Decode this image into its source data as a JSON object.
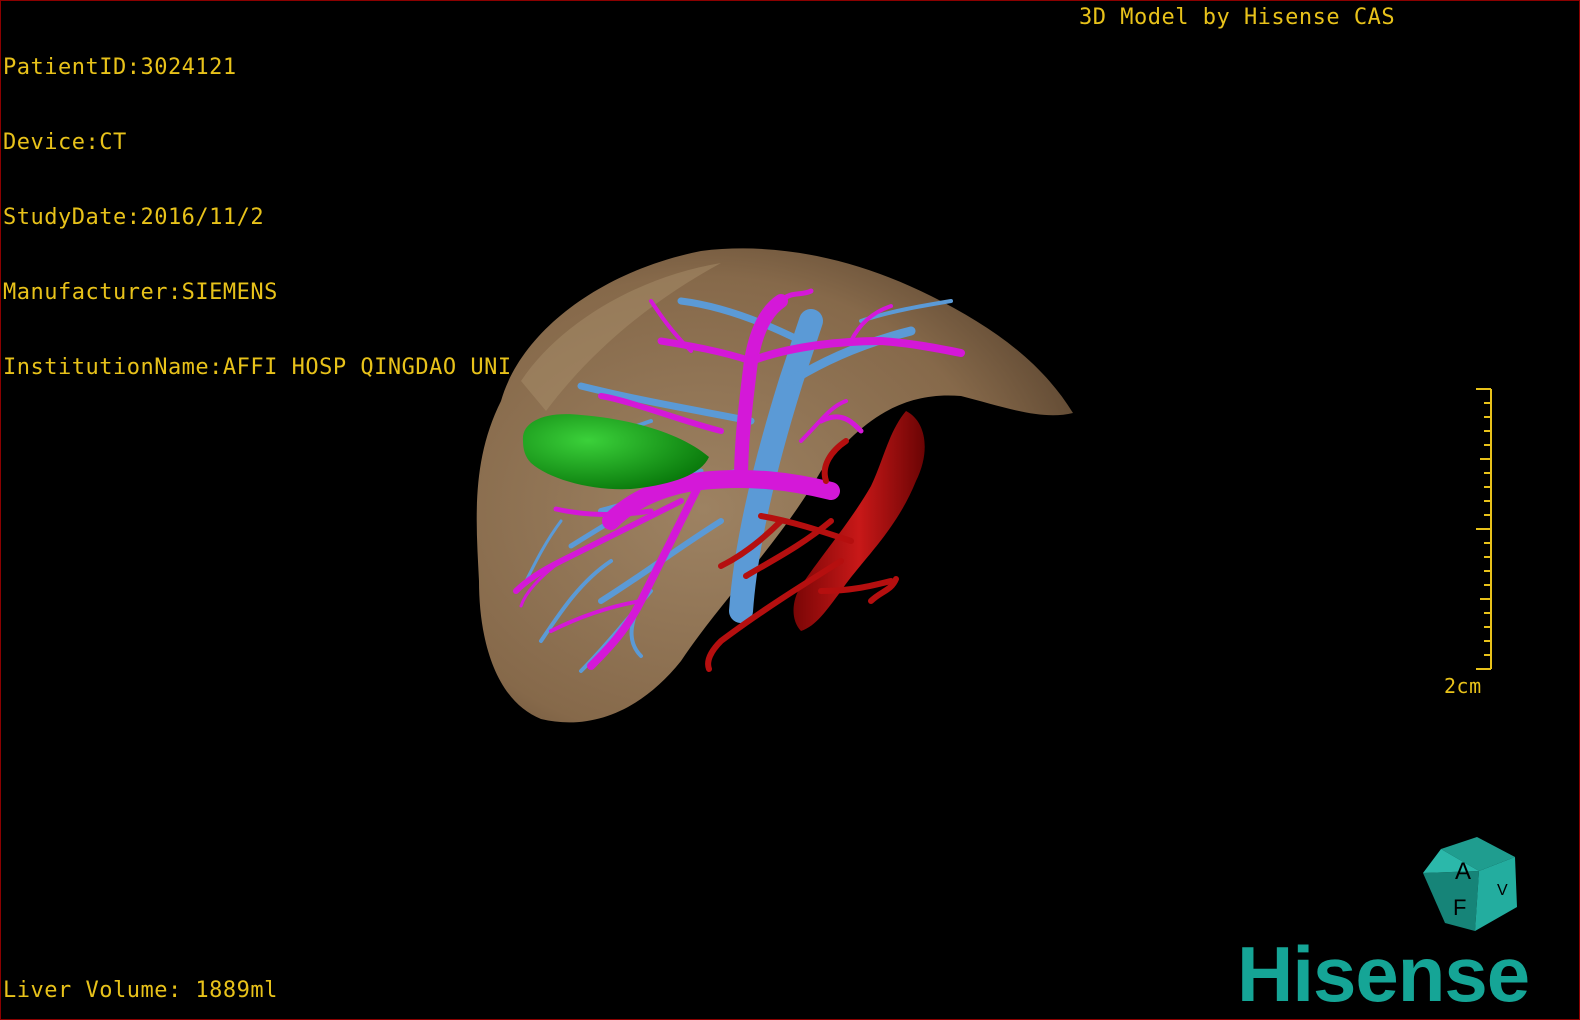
{
  "patient_info": {
    "patient_id": "PatientID:3024121",
    "device": "Device:CT",
    "study_date": "StudyDate:2016/11/2",
    "manufacturer": "Manufacturer:SIEMENS",
    "institution": "InstitutionName:AFFI HOSP QINGDAO UNI"
  },
  "header_right": "3D Model by Hisense CAS",
  "liver_volume": "Liver Volume: 1889ml",
  "scale_bar": {
    "label": "2cm"
  },
  "orientation_cube": {
    "face_top": "A",
    "face_front": "F",
    "face_side": "V"
  },
  "brand": "Hisense",
  "colors": {
    "overlay_text": "#e8c21a",
    "liver": "#8c7355",
    "portal_vein": "#5b9ad6",
    "hepatic_artery_branches": "#d418d8",
    "aorta": "#b50f0f",
    "gallbladder": "#0fa012",
    "brand": "#15a596"
  },
  "model": {
    "structures": [
      "liver",
      "gallbladder",
      "portal-vein",
      "hepatic-artery",
      "aorta"
    ]
  }
}
